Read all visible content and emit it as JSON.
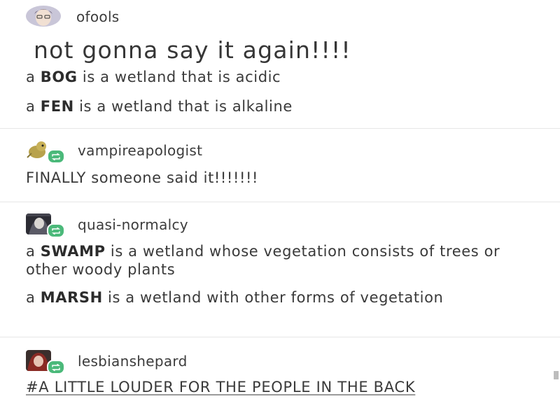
{
  "posts": [
    {
      "username": "ofools",
      "headline": "not gonna say it again!!!!",
      "lines": [
        {
          "pre": "a ",
          "bold": "BOG",
          "post": " is a wetland that is acidic"
        },
        {
          "pre": "a ",
          "bold": "FEN",
          "post": " is a wetland that is alkaline"
        }
      ]
    },
    {
      "username": "vampireapologist",
      "lines": [
        {
          "text": "FINALLY someone said it!!!!!!!"
        }
      ]
    },
    {
      "username": "quasi-normalcy",
      "lines": [
        {
          "pre": "a ",
          "bold": "SWAMP",
          "post": " is a wetland whose vegetation consists of trees or other woody plants"
        },
        {
          "pre": "a ",
          "bold": "MARSH",
          "post": " is a wetland with other forms of vegetation"
        }
      ]
    },
    {
      "username": "lesbianshepard",
      "tag": "#A LITTLE LOUDER FOR THE PEOPLE IN THE BACK"
    }
  ],
  "colors": {
    "reblog_badge": "#4bb97a",
    "divider": "#e6e6e6",
    "text": "#3a3a3a"
  },
  "icons": [
    "reblog-icon"
  ]
}
